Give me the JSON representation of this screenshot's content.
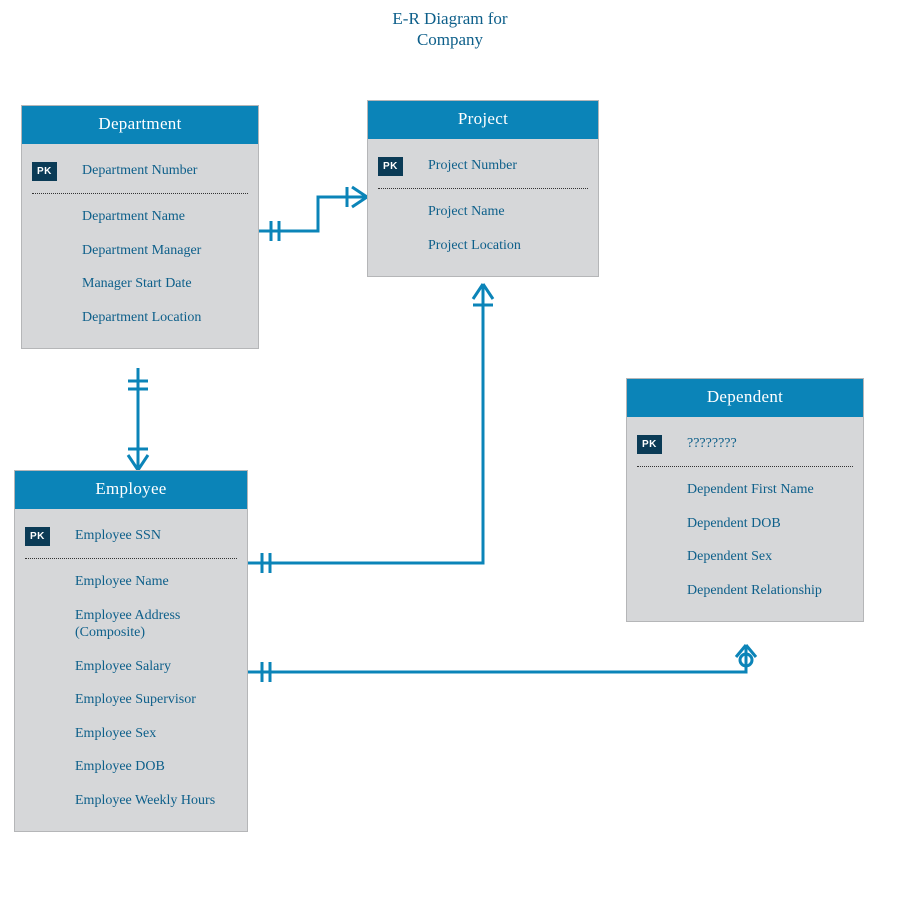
{
  "title_line1": "E-R Diagram for",
  "title_line2": "Company",
  "pk_label": "PK",
  "entities": {
    "department": {
      "name": "Department",
      "pk": "Department Number",
      "attrs": [
        "Department Name",
        "Department Manager",
        "Manager Start Date",
        "Department Location"
      ]
    },
    "project": {
      "name": "Project",
      "pk": "Project Number",
      "attrs": [
        "Project Name",
        "Project Location"
      ]
    },
    "employee": {
      "name": "Employee",
      "pk": "Employee SSN",
      "attrs": [
        "Employee Name",
        "Employee Address (Composite)",
        "Employee Salary",
        "Employee Supervisor",
        "Employee Sex",
        "Employee DOB",
        "Employee Weekly Hours"
      ]
    },
    "dependent": {
      "name": "Dependent",
      "pk": "????????",
      "attrs": [
        "Dependent First Name",
        "Dependent DOB",
        "Dependent Sex",
        "Dependent Relationship"
      ]
    }
  },
  "relationships": [
    {
      "from": "Department",
      "to": "Project",
      "from_card": "one-mandatory",
      "to_card": "many-mandatory"
    },
    {
      "from": "Department",
      "to": "Employee",
      "from_card": "one-mandatory",
      "to_card": "many-mandatory"
    },
    {
      "from": "Employee",
      "to": "Project",
      "from_card": "one-mandatory",
      "to_card": "many-mandatory"
    },
    {
      "from": "Employee",
      "to": "Dependent",
      "from_card": "one-mandatory",
      "to_card": "many-optional"
    }
  ]
}
